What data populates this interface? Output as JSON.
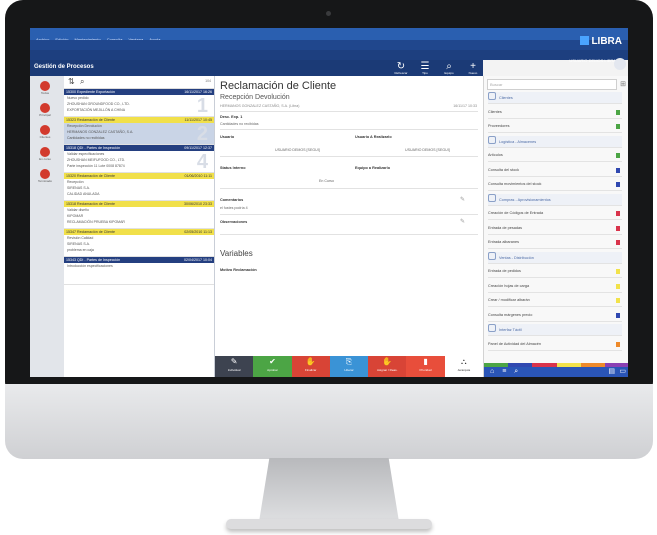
{
  "app": {
    "menu": [
      "Archivo",
      "Edición",
      "Mantenimiento",
      "Consulta",
      "Ventana",
      "Ayuda"
    ],
    "brand": "LIBRA",
    "sub_title": "Nuevo gestor de procesos",
    "user": "USUARIO DEMOS LIBRA"
  },
  "header": {
    "title": "Gestión de Procesos",
    "buttons": [
      {
        "label": "Refrescar",
        "glyph": "↻"
      },
      {
        "label": "Tipo",
        "glyph": "☰"
      },
      {
        "label": "Equipo",
        "glyph": "⌕"
      },
      {
        "label": "Nuevo",
        "glyph": "+"
      }
    ]
  },
  "rail": [
    {
      "label": "Todos"
    },
    {
      "label": "Principal"
    },
    {
      "label": "Clientes"
    },
    {
      "label": "En curso"
    },
    {
      "label": "Terminado"
    }
  ],
  "list": {
    "count": "104",
    "cards": [
      {
        "code": "15300",
        "type": "Expediente Exportación",
        "date": "16/11/2017 16:26",
        "lines": [
          "Nuevo pedido",
          "ZHOUSHAN GROUNDFOOD CO., LTD.",
          "EXPORTACIÓN MEJILLÓN A CHINA"
        ],
        "color": "blue",
        "num": "1"
      },
      {
        "code": "15323",
        "type": "Reclamación de Cliente",
        "date": "11/11/2017 10:45",
        "lines": [
          "Recepción Devolución",
          "HERMANOS GONZALEZ CASTAÑO, S.A.",
          "Cantidades no recibidas"
        ],
        "color": "yellow",
        "num": "2",
        "selected": true
      },
      {
        "code": "15318",
        "type": "QDI - Partes de Inspección",
        "date": "09/11/2017 12:37",
        "lines": [
          "Validar especificaciones",
          "ZHOUSHAN MEIFUFOOD CO., LTD.",
          "Parte inspección 11 Lote 0008 87874"
        ],
        "color": "blue",
        "num": "4"
      },
      {
        "code": "15320",
        "type": "Reclamación de Cliente",
        "date": "01/06/2010 11:11",
        "lines": [
          "Recepción",
          "SIRENAS S.A.",
          "CALIDAD ANULADA"
        ],
        "color": "yellow",
        "num": ""
      },
      {
        "code": "15318",
        "type": "Reclamación de Cliente",
        "date": "30/06/2010 23:33",
        "lines": [
          "Validar diseño",
          "KIPOMAR",
          "RECLAMACIÓN PRUEBA KIPOMAR"
        ],
        "color": "yellow",
        "num": ""
      },
      {
        "code": "15347",
        "type": "Reclamación de Cliente",
        "date": "02/05/2010 11:13",
        "lines": [
          "Revisión Calidad",
          "SIRENAS S.A.",
          "problema en caja"
        ],
        "color": "yellow",
        "num": ""
      },
      {
        "code": "15343",
        "type": "QDI - Partes de Inspección",
        "date": "02/04/2017 10:04",
        "lines": [
          "Introducción especificaciones"
        ],
        "color": "blue",
        "num": ""
      }
    ]
  },
  "detail": {
    "title": "Reclamación de Cliente",
    "subtitle": "Recepción Devolución",
    "client": "HERMANOS GONZALEZ CASTAÑO, S.A. (Libra)",
    "date": "16/11/17 10:33",
    "doc": "Desc. Exp. 1",
    "desc": "Cantidades no recibidas",
    "user_label": "Usuario",
    "user_assigned_label": "Usuario A Realizarlo",
    "user_value": "USUARIO DEMOS [SEGUI]",
    "user_assigned_value": "USUARIO DEMOS [SEGUI]",
    "state_label": "Status Interno",
    "team_label": "Equipo a Realizarlo",
    "state_value": "En Curso",
    "comments_label": "Comentarios",
    "comments_value": "el fustes podría 4",
    "notes_label": "Observaciones",
    "vars_label": "Variables",
    "reason_label": "Motivo Reclamación"
  },
  "actions": [
    {
      "label": "Individual",
      "glyph": "✎",
      "color": "#3d4350"
    },
    {
      "label": "Aprobar",
      "glyph": "✔",
      "color": "#4ca545"
    },
    {
      "label": "Finalizar",
      "glyph": "✋",
      "color": "#d84436"
    },
    {
      "label": "Liberar",
      "glyph": "⎘",
      "color": "#3a93d6"
    },
    {
      "label": "Asignar / Reas.",
      "glyph": "✋",
      "color": "#d84436"
    },
    {
      "label": "Prioridad",
      "glyph": "▮",
      "color": "#e84e3b"
    },
    {
      "label": "Jerarquía",
      "glyph": "⛬",
      "color": "#ffffff"
    }
  ],
  "right": {
    "search_placeholder": "Buscar",
    "rows": [
      {
        "label": "Clientes",
        "type": "sec"
      },
      {
        "label": "Clientes",
        "flag": "#4ca545"
      },
      {
        "label": "Proveedores",
        "flag": "#4ca545"
      },
      {
        "label": "Logística - Almacenes",
        "type": "sec"
      },
      {
        "label": "Artículos",
        "flag": "#4ca545"
      },
      {
        "label": "Consulta del stock",
        "flag": "#3048b0"
      },
      {
        "label": "Consulta movimientos del stock",
        "flag": "#3048b0"
      },
      {
        "label": "Compras - Aprovisionamientos",
        "type": "sec"
      },
      {
        "label": "Creación de Códigos de Entrada",
        "flag": "#d9334b"
      },
      {
        "label": "Entrada de pesadas",
        "flag": "#d9334b"
      },
      {
        "label": "Entrada albaranes",
        "flag": "#d9334b"
      },
      {
        "label": "Ventas - Distribución",
        "type": "sec"
      },
      {
        "label": "Entrada de pedidos",
        "flag": "#f2e24a"
      },
      {
        "label": "Creación hojas de carga",
        "flag": "#f2e24a"
      },
      {
        "label": "Crear / modificar albarán",
        "flag": "#f2e24a"
      },
      {
        "label": "Consulta márgenes precio",
        "flag": "#3048b0"
      },
      {
        "label": "Interfaz Táctil",
        "type": "sec"
      },
      {
        "label": "Panel de Actividad del Almacén",
        "flag": "#ee8a2a"
      }
    ],
    "colorbar": [
      "#4ca545",
      "#3048b0",
      "#d9334b",
      "#f2e24a",
      "#ee8a2a",
      "#8a3fb3"
    ]
  }
}
